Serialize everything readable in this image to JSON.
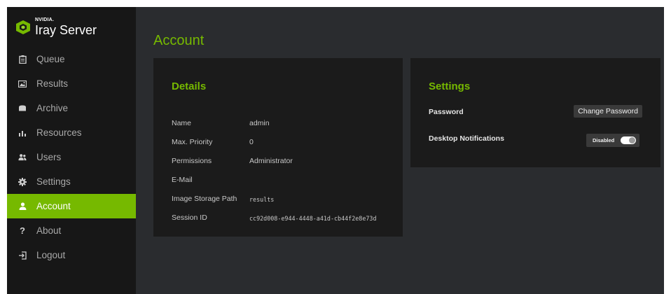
{
  "brand": {
    "company": "NVIDIA.",
    "product": "Iray Server",
    "accent": "#76b900"
  },
  "nav": {
    "items": [
      {
        "label": "Queue",
        "icon": "clipboard-icon"
      },
      {
        "label": "Results",
        "icon": "image-icon"
      },
      {
        "label": "Archive",
        "icon": "archive-icon"
      },
      {
        "label": "Resources",
        "icon": "bar-chart-icon"
      },
      {
        "label": "Users",
        "icon": "users-icon"
      },
      {
        "label": "Settings",
        "icon": "gear-icon"
      },
      {
        "label": "Account",
        "icon": "user-icon",
        "active": true
      },
      {
        "label": "About",
        "icon": "question-icon"
      },
      {
        "label": "Logout",
        "icon": "logout-icon"
      }
    ]
  },
  "page": {
    "title": "Account"
  },
  "details": {
    "title": "Details",
    "rows": [
      {
        "label": "Name",
        "value": "admin"
      },
      {
        "label": "Max. Priority",
        "value": "0"
      },
      {
        "label": "Permissions",
        "value": "Administrator"
      },
      {
        "label": "E-Mail",
        "value": ""
      },
      {
        "label": "Image Storage Path",
        "value": "results"
      },
      {
        "label": "Session ID",
        "value": "cc92d008-e944-4448-a41d-cb44f2e8e73d"
      }
    ]
  },
  "settings": {
    "title": "Settings",
    "password_label": "Password",
    "change_password_label": "Change Password",
    "notifications_label": "Desktop Notifications",
    "notifications_state": "Disabled"
  }
}
